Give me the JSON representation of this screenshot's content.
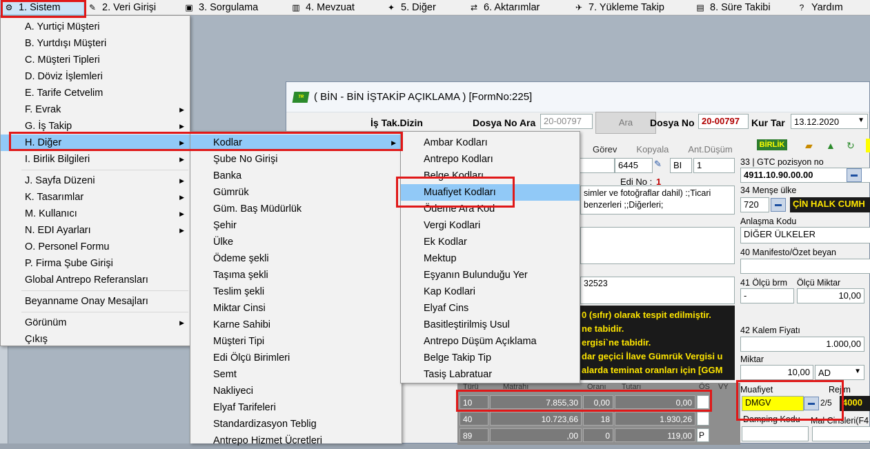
{
  "menubar": {
    "items": [
      {
        "label": "1.  Sistem",
        "icon": "system-icon"
      },
      {
        "label": "2.  Veri Girişi",
        "icon": "edit-icon"
      },
      {
        "label": "3.  Sorgulama",
        "icon": "query-icon"
      },
      {
        "label": "4.  Mevzuat",
        "icon": "books-icon"
      },
      {
        "label": "5.  Diğer",
        "icon": "other-icon"
      },
      {
        "label": "6.  Aktarımlar",
        "icon": "transfer-icon"
      },
      {
        "label": "7.  Yükleme Takip",
        "icon": "truck-icon"
      },
      {
        "label": "8. Süre Takibi",
        "icon": "clipboard-icon"
      },
      {
        "label": "Yardım",
        "icon": "help-icon"
      }
    ]
  },
  "menu1": {
    "items": [
      "A.  Yurtiçi Müşteri",
      "B.  Yurtdışı Müşteri",
      "C.  Müşteri Tipleri",
      "D.  Döviz İşlemleri",
      "E.  Tarife Cetvelim",
      "F.  Evrak",
      "G.  İş Takip",
      "H.  Diğer",
      "I.  Birlik Bilgileri",
      "J.  Sayfa Düzeni",
      "K.  Tasarımlar",
      "M.  Kullanıcı",
      "N.  EDI Ayarları",
      "O.  Personel Formu",
      "P.  Firma Şube Girişi",
      "Global Antrepo Referansları",
      "Beyanname Onay Mesajları",
      "Görünüm",
      "Çıkış"
    ]
  },
  "menu2": {
    "items": [
      "Kodlar",
      "Şube No Girişi",
      "Banka",
      "Gümrük",
      "Güm. Baş Müdürlük",
      "Şehir",
      "Ülke",
      "Ödeme şekli",
      "Taşıma şekli",
      "Teslim şekli",
      "Miktar Cinsi",
      "Karne Sahibi",
      "Müşteri  Tipi",
      "Edi Ölçü Birimleri",
      "Semt",
      "Nakliyeci",
      "Elyaf Tarifeleri",
      "Standardizasyon Teblig",
      "Antrepo Hizmet Ücretleri"
    ]
  },
  "menu3": {
    "items": [
      "Ambar Kodları",
      "Antrepo Kodları",
      "Belge Kodları",
      "Muafiyet Kodları",
      "Ödeme Ara Kod",
      "Vergi Kodlari",
      "Ek Kodlar",
      "Mektup",
      "Eşyanın Bulunduğu Yer",
      "Kap Kodlari",
      "Elyaf Cins",
      "Basitleştirilmiş Usul",
      "Antrepo Düşüm Açıklama",
      "Belge Takip Tip",
      "Tasiş Labratuar"
    ]
  },
  "form": {
    "title": "( BİN - BİN İŞTAKİP AÇIKLAMA ) [FormNo:225]",
    "is_tak_dizin": "İş Tak.Dizin",
    "dosya_no_ara_label": "Dosya No Ara",
    "dosya_no_ara_value": "20-00797",
    "ara_button": "Ara",
    "dosya_no_label": "Dosya No",
    "dosya_no_value": "20-00797",
    "kur_tar_label": "Kur Tar",
    "kur_tar_value": "13.12.2020",
    "tabs": [
      "Görev",
      "Kopyala",
      "Ant.Düşüm"
    ],
    "birlik": "BİRLİK",
    "field_6445": "6445",
    "field_bi": "BI",
    "field_1": "1",
    "edi_no_label": "Edi No :",
    "edi_no_value": "1",
    "desc_text": "simler ve fotoğraflar dahil) :;Ticari benzerleri ;;Diğerleri;",
    "code_32523": "32523",
    "warn_lines": [
      "0 (sıfır) olarak tespit edilmiştir.",
      "ne tabidir.",
      "ergisi`ne tabidir.",
      "dar geçici İlave Gümrük Vergisi u",
      "alarda teminat oranları için [GGM"
    ],
    "gtc_label": "33 | GTC pozisyon no",
    "gtc_value": "4911.10.90.00.00",
    "mense_label": "34 Menşe ülke",
    "mense_code": "720",
    "mense_country": "ÇİN HALK CUMH",
    "anlasma_label": "Anlaşma Kodu",
    "anlasma_value": "DİĞER ÜLKELER",
    "manifesto_label": "40 Manifesto/Özet beyan",
    "olcu_brm_label": "41 Ölçü brm",
    "olcu_miktar_label": "Ölçü Miktar",
    "olcu_brm_value": "-",
    "olcu_miktar_value": "10,00",
    "kalem_fiyati_label": "42 Kalem Fiyatı",
    "kalem_fiyati_value": "1.000,00",
    "miktar_label": "Miktar",
    "miktar_value": "10,00",
    "miktar_unit": "AD",
    "muafiyet_label": "Muafiyet",
    "muafiyet_value": "DMGV",
    "muafiyet_count": "2/5",
    "rejim_label": "Rejim",
    "rejim_value": "4000",
    "damping_label": "Damping Kodu",
    "mal_cinsleri_label": "Mal Cinsleri(F4",
    "grid_headers": [
      "Türü",
      "Matrahı",
      "Oranı",
      "Tutarı",
      "ÖS",
      "VY"
    ],
    "grid_rows": [
      {
        "turu": "10",
        "matrah": "7.855,30",
        "oran": "0,00",
        "tutar": "0,00",
        "os": ""
      },
      {
        "turu": "40",
        "matrah": "10.723,66",
        "oran": "18",
        "tutar": "1.930,26",
        "os": ""
      },
      {
        "turu": "89",
        "matrah": ",00",
        "oran": "0",
        "tutar": "119,00",
        "os": "P"
      }
    ]
  }
}
